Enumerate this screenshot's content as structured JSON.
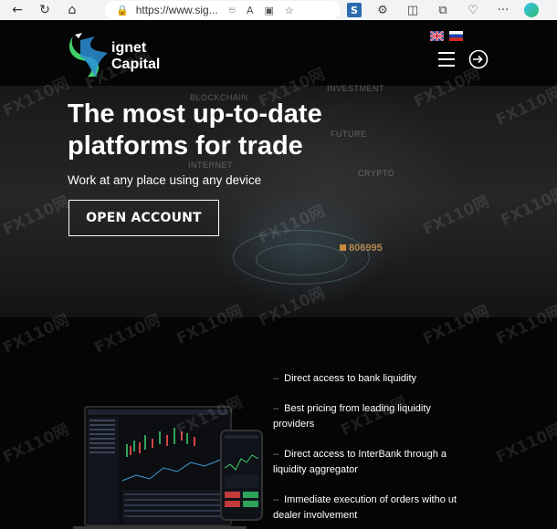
{
  "browser": {
    "url": "https://www.sig...",
    "nav_icons": [
      "back-icon",
      "reload-icon",
      "home-icon"
    ],
    "address_icons": [
      "lock-icon",
      "translate-icon",
      "read-aloud-icon",
      "media-icon",
      "favorite-icon"
    ],
    "toolbar_icons": [
      "extension-s-icon",
      "extensions-icon",
      "split-screen-icon",
      "collections-icon",
      "heart-icon",
      "more-icon",
      "edge-icon"
    ],
    "translate_glyph": "ಅ",
    "read_aloud_glyph": "A",
    "more_glyph": "···"
  },
  "header": {
    "logo_line1": "ignet",
    "logo_line2": "Capital",
    "languages": [
      "English",
      "Русский"
    ],
    "menu_icon": "hamburger-icon",
    "login_icon": "login-icon"
  },
  "hero": {
    "title_line1": "The most up-to-date",
    "title_line2": "platforms for trade",
    "subtitle": "Work at any place using any device",
    "cta_label": "OPEN ACCOUNT",
    "background_words": [
      "BLOCKCHAIN",
      "FUTURE",
      "INTERNET",
      "CRYPTO",
      "INVESTMENT"
    ],
    "background_number": "806995"
  },
  "features": [
    "Direct access to bank liquidity",
    "Best pricing from leading liquidity providers",
    "Direct access to InterBank through a liquidity aggregator",
    "Immediate execution of orders witho ut dealer involvement"
  ],
  "features_dash": "–",
  "watermark_text": "FX110网",
  "colors": {
    "background": "#050505",
    "text": "#ffffff",
    "logo_green": "#3fd16a",
    "logo_blue": "#2b8fd6"
  }
}
